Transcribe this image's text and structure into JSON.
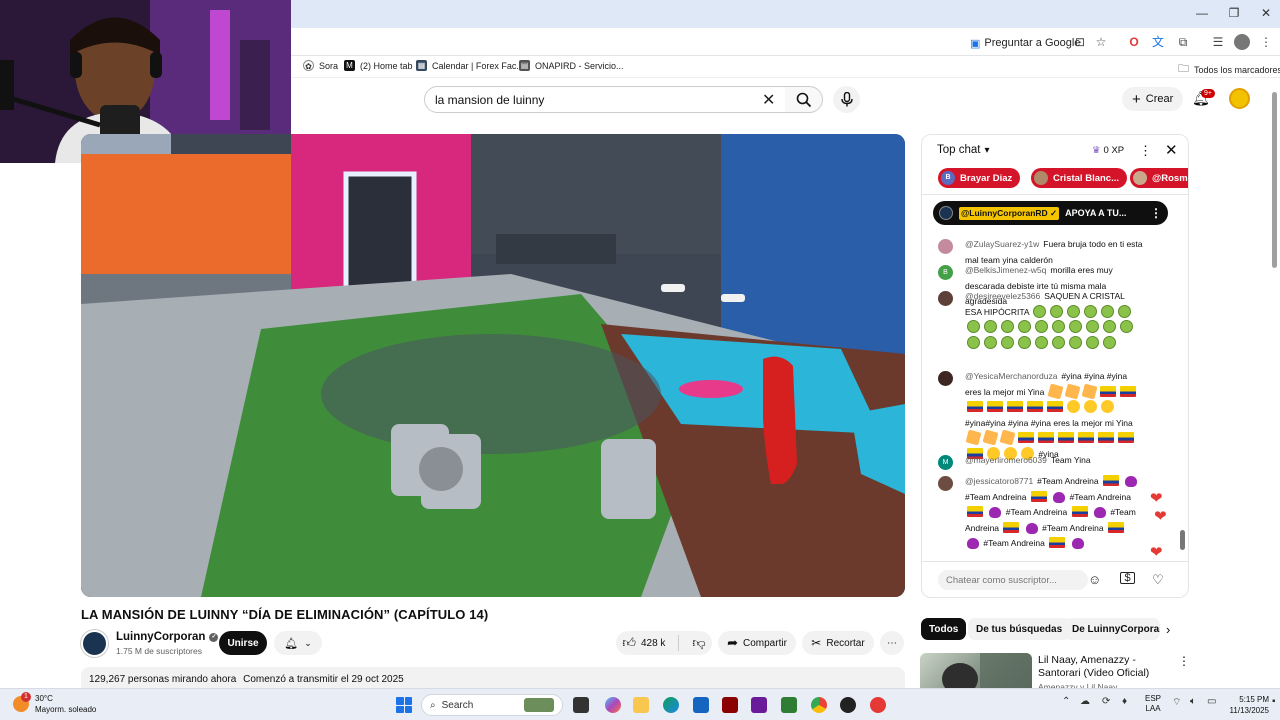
{
  "browser": {
    "translate_label": "Preguntar a Google",
    "bookmarks": [
      {
        "label": "Sora",
        "icon": "sora-icon"
      },
      {
        "label": "(2) Home tab",
        "icon": "medium-icon"
      },
      {
        "label": "Calendar | Forex Fac...",
        "icon": "forex-icon"
      },
      {
        "label": "ONAPIRD - Servicio...",
        "icon": "onapi-icon"
      }
    ],
    "all_bookmarks_label": "Todos los marcadores"
  },
  "youtube": {
    "search_value": "la mansion de luinny",
    "create_label": "Crear",
    "notifications_badge": "9+"
  },
  "video": {
    "title": "LA MANSIÓN DE LUINNY “DÍA DE ELIMINACIÓN” (CAPÍTULO 14)",
    "channel_name": "LuinnyCorporan",
    "subscribers": "1.75 M de suscriptores",
    "join_label": "Unirse",
    "likes": "428 k",
    "share_label": "Compartir",
    "clip_label": "Recortar",
    "watching_now": "129,267 personas mirando ahora",
    "stream_started": "Comenzó a transmitir el 29 oct 2025"
  },
  "chat": {
    "header_label": "Top chat",
    "xp_label": "0 XP",
    "gifters": [
      {
        "name": "Brayar Diaz",
        "initial": "B"
      },
      {
        "name": "Cristal Blanc...",
        "initial": ""
      },
      {
        "name": "@Rosme",
        "initial": ""
      }
    ],
    "pinned": {
      "author": "@LuinnyCorporanRD",
      "text": "APOYA A TU..."
    },
    "messages": [
      {
        "author": "@ZulaySuarez-y1w",
        "text": "Fuera bruja todo en ti esta mal team yina calderón",
        "initial": "",
        "color": "#c48b9f"
      },
      {
        "author": "@BelkisJimenez-w5q",
        "text": "morilla eres muy descarada debiste irte tú misma mala agradesida",
        "initial": "B",
        "color": "#43a047"
      },
      {
        "author": "@desireevelez5366",
        "text": "SAQUEN A CRISTAL ESA HIPÓCRITA",
        "initial": "",
        "color": "#5d4037"
      },
      {
        "author": "@YesicaMerchanorduza",
        "text": "#yina #yina #yina eres la mejor mi Yina",
        "text2": "#yina#yina #yina",
        "text3": "#yina eres la mejor mi Yina",
        "text4": "#yina",
        "initial": "",
        "color": "#3e2723"
      },
      {
        "author": "@mayerliromero6039",
        "text": "Team Yina",
        "initial": "M",
        "color": "#00897b"
      },
      {
        "author": "@jessicatoro8771",
        "text": "#Team Andreina",
        "text2": "#Team Andreina",
        "text3": "#Team Andreina",
        "text4": "#Team Andreina",
        "text5": "#Team Andreina",
        "text6": "#Team Andreina",
        "text7": "#Team",
        "text8": "Andreina",
        "initial": "",
        "color": "#6d4c41"
      }
    ],
    "input_placeholder": "Chatear como suscriptor..."
  },
  "recommendations": {
    "chips": [
      "Todos",
      "De tus búsquedas",
      "De LuinnyCorporan"
    ],
    "items": [
      {
        "title": "Lil Naay, Amenazzy - Santorari (Video Oficial)",
        "channel": "Amenazzy y Lil Naay"
      }
    ]
  },
  "taskbar": {
    "temperature": "30°C",
    "weather_text": "Mayorm. soleado",
    "weather_badge": "1",
    "search_label": "Search",
    "lang_line1": "ESP",
    "lang_line2": "LAA",
    "time": "5:15 PM",
    "date": "11/13/2025"
  }
}
